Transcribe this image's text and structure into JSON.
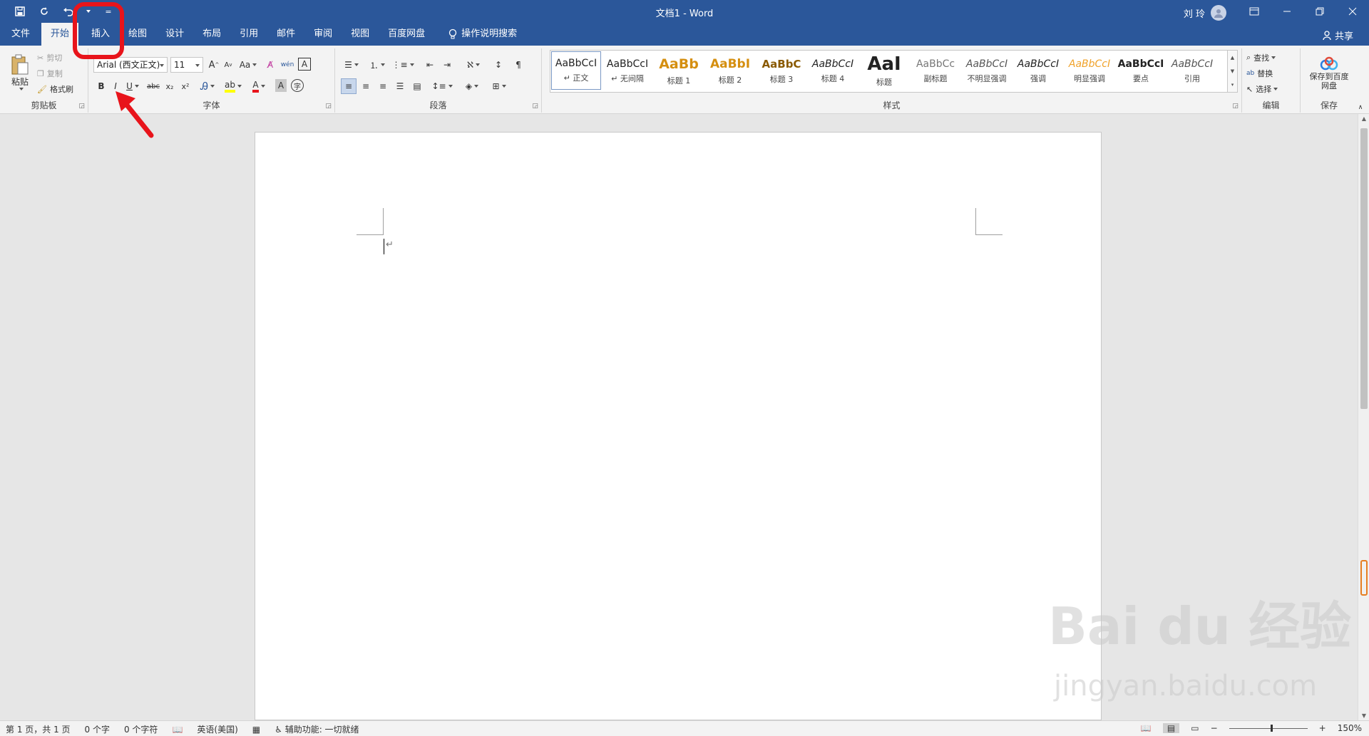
{
  "titlebar": {
    "doc_title": "文档1  -  Word",
    "user_name": "刘 玲",
    "qat_more": "="
  },
  "tabs": [
    {
      "label": "文件"
    },
    {
      "label": "开始"
    },
    {
      "label": "插入"
    },
    {
      "label": "绘图"
    },
    {
      "label": "设计"
    },
    {
      "label": "布局"
    },
    {
      "label": "引用"
    },
    {
      "label": "邮件"
    },
    {
      "label": "审阅"
    },
    {
      "label": "视图"
    },
    {
      "label": "百度网盘"
    }
  ],
  "tellme": "操作说明搜索",
  "share": "共享",
  "clipboard": {
    "paste": "粘贴",
    "cut": "剪切",
    "copy": "复制",
    "format_painter": "格式刷",
    "label": "剪贴板"
  },
  "font": {
    "family": "Arial (西文正文)",
    "size": "11",
    "label": "字体",
    "bold": "B",
    "italic": "I",
    "underline": "U",
    "strike": "abc",
    "sub": "x₂",
    "sup": "x²",
    "change_case": "Aa",
    "wen": "wén",
    "grow": "A",
    "shrink": "A"
  },
  "paragraph": {
    "label": "段落"
  },
  "styles": {
    "label": "样式",
    "items": [
      {
        "sample": "AaBbCcI",
        "name": "↵ 正文"
      },
      {
        "sample": "AaBbCcI",
        "name": "↵ 无间隔"
      },
      {
        "sample": "AaBb",
        "name": "标题 1"
      },
      {
        "sample": "AaBbI",
        "name": "标题 2"
      },
      {
        "sample": "AaBbC",
        "name": "标题 3"
      },
      {
        "sample": "AaBbCcI",
        "name": "标题 4"
      },
      {
        "sample": "AaI",
        "name": "标题"
      },
      {
        "sample": "AaBbCc",
        "name": "副标题"
      },
      {
        "sample": "AaBbCcI",
        "name": "不明显强调"
      },
      {
        "sample": "AaBbCcI",
        "name": "强调"
      },
      {
        "sample": "AaBbCcI",
        "name": "明显强调"
      },
      {
        "sample": "AaBbCcI",
        "name": "要点"
      },
      {
        "sample": "AaBbCcI",
        "name": "引用"
      }
    ]
  },
  "editing": {
    "find": "查找",
    "replace": "替换",
    "select": "选择",
    "label": "编辑"
  },
  "save": {
    "button": "保存到百度网盘",
    "label": "保存"
  },
  "statusbar": {
    "page": "第 1 页，共 1 页",
    "words": "0 个字",
    "chars": "0 个字符",
    "language": "英语(美国)",
    "accessibility": "辅助功能: 一切就绪",
    "zoom": "150%",
    "zoom_minus": "−",
    "zoom_plus": "+"
  },
  "document": {
    "para_mark": "↵"
  },
  "watermark": {
    "main": "Bai du 经验",
    "sub": "jingyan.baidu.com"
  },
  "colors": {
    "brand": "#2b579a",
    "annotation": "#e8141b"
  }
}
